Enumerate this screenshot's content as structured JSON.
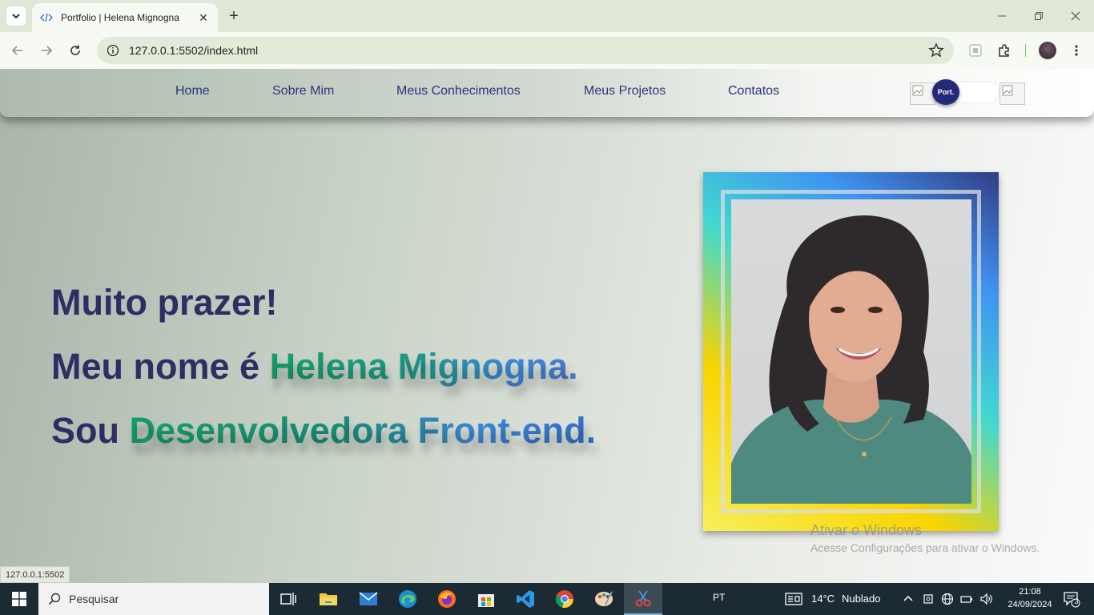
{
  "browser": {
    "tab_title": "Portfolio | Helena Mignogna",
    "url": "127.0.0.1:5502/index.html",
    "status_url": "127.0.0.1:5502"
  },
  "site": {
    "nav": [
      "Home",
      "Sobre Mim",
      "Meus Conhecimentos",
      "Meus Projetos",
      "Contatos"
    ],
    "toggle_label": "Port."
  },
  "hero": {
    "line1": "Muito prazer!",
    "line2_prefix": "Meu nome é ",
    "line2_highlight": "Helena Mignogna.",
    "line3_prefix": "Sou ",
    "line3_highlight": "Desenvolvedora Front-end."
  },
  "watermark": {
    "title": "Ativar o Windows",
    "subtitle": "Acesse Configurações para ativar o Windows."
  },
  "taskbar": {
    "search_placeholder": "Pesquisar",
    "lang": "PT",
    "weather_temp": "14°C",
    "weather_desc": "Nublado",
    "time": "21:08",
    "date": "24/09/2024",
    "notifications": "3"
  },
  "colors": {
    "nav_link": "#2b357e",
    "hero_text": "#2b2f64",
    "toggle_knob": "#242a7a"
  }
}
